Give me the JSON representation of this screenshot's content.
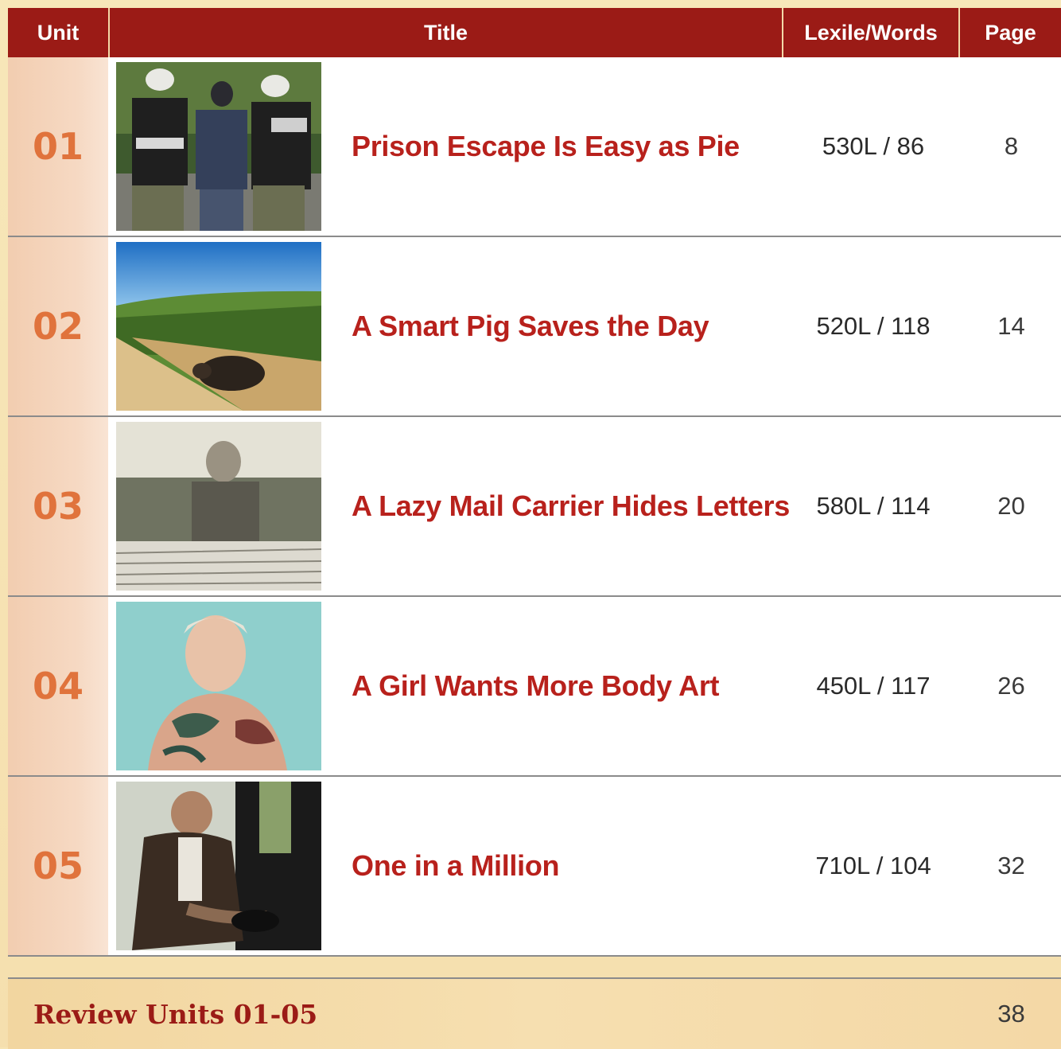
{
  "header": {
    "unit": "Unit",
    "title": "Title",
    "lexile_words": "Lexile/Words",
    "page": "Page"
  },
  "units": [
    {
      "unit": "01",
      "title": "Prison Escape Is Easy as Pie",
      "lexile_words": "530L / 86",
      "page": "8",
      "image": "police-arrest-photo"
    },
    {
      "unit": "02",
      "title": "A Smart Pig Saves the Day",
      "lexile_words": "520L / 118",
      "page": "14",
      "image": "pig-vineyard-photo"
    },
    {
      "unit": "03",
      "title": "A Lazy Mail Carrier Hides Letters",
      "lexile_words": "580L / 114",
      "page": "20",
      "image": "mail-carrier-letters-photo"
    },
    {
      "unit": "04",
      "title": "A Girl Wants More Body Art",
      "lexile_words": "450L / 117",
      "page": "26",
      "image": "tattooed-girl-photo"
    },
    {
      "unit": "05",
      "title": "One in a Million",
      "lexile_words": "710L / 104",
      "page": "32",
      "image": "man-shoe-shine-photo"
    }
  ],
  "review": {
    "label": "Review Units 01-05",
    "page": "38"
  },
  "colors": {
    "header_bg": "#9b1b16",
    "title_red": "#b8211c",
    "unit_orange": "#e0733c",
    "page_bg": "#f6e4b4"
  }
}
